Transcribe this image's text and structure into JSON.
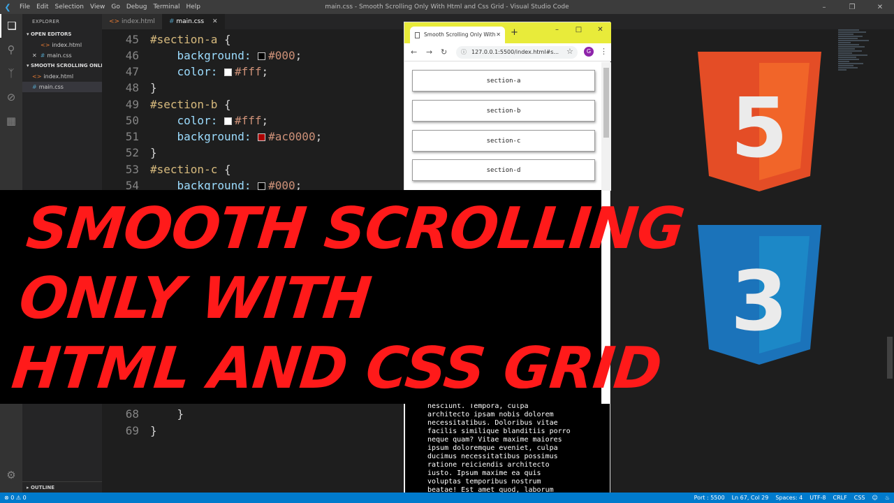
{
  "window": {
    "title": "main.css - Smooth Scrolling Only With Html and Css Grid - Visual Studio Code",
    "menu": [
      "File",
      "Edit",
      "Selection",
      "View",
      "Go",
      "Debug",
      "Terminal",
      "Help"
    ]
  },
  "sidebar": {
    "header": "EXPLORER",
    "open_editors_label": "OPEN EDITORS",
    "open_editors": [
      {
        "name": "index.html",
        "type": "html"
      },
      {
        "name": "main.css",
        "type": "css",
        "dirty_icon": "close-icon"
      }
    ],
    "project_label": "SMOOTH SCROLLING ONLI...",
    "files": [
      {
        "name": "index.html",
        "type": "html"
      },
      {
        "name": "main.css",
        "type": "css"
      }
    ],
    "outline_label": "OUTLINE"
  },
  "tabs": [
    {
      "label": "index.html",
      "active": false
    },
    {
      "label": "main.css",
      "active": true
    }
  ],
  "code": {
    "l45": {
      "num": "45",
      "selector": "#section-a",
      "brace": " {"
    },
    "l46": {
      "num": "46",
      "prop": "background:",
      "swatch": "#000000",
      "value": "#000",
      "end": ";"
    },
    "l47": {
      "num": "47",
      "prop": "color:",
      "swatch": "#ffffff",
      "value": "#fff",
      "end": ";"
    },
    "l48": {
      "num": "48",
      "text": "}"
    },
    "l49": {
      "num": "49",
      "selector": "#section-b",
      "brace": " {"
    },
    "l50": {
      "num": "50",
      "prop": "color:",
      "swatch": "#ffffff",
      "value": "#fff",
      "end": ";"
    },
    "l51": {
      "num": "51",
      "prop": "background:",
      "swatch": "#ac0000",
      "value": "#ac0000",
      "end": ";"
    },
    "l52": {
      "num": "52",
      "text": "}"
    },
    "l53": {
      "num": "53",
      "selector": "#section-c",
      "brace": " {"
    },
    "l54": {
      "num": "54",
      "prop": "background:",
      "swatch": "#000000",
      "value": "#000",
      "end": ";"
    },
    "l68": {
      "num": "68",
      "text": "}"
    },
    "l69": {
      "num": "69",
      "text": "}"
    }
  },
  "status": {
    "errors": "0",
    "warnings": "0",
    "port": "Port : 5500",
    "position": "Ln 67, Col 29",
    "spaces": "Spaces: 4",
    "encoding": "UTF-8",
    "eol": "CRLF",
    "language": "CSS"
  },
  "browser": {
    "tab_title": "Smooth Scrolling Only With",
    "url": "127.0.0.1:5500/index.html#s...",
    "avatar": "G",
    "header_color": "#e8eb3a",
    "nav_buttons": [
      "section-a",
      "section-b",
      "section-c",
      "section-d"
    ],
    "body_text": "nesciunt. Tempora, culpa\narchitecto ipsam nobis dolorem\nnecessitatibus. Doloribus vitae\nfacilis similique blanditiis porro\nneque quam? Vitae maxime maiores\nipsum doloremque eveniet, culpa\nducimus necessitatibus possimus\nratione reiciendis architecto\niusto. Ipsum maxime ea quis\nvoluptas temporibus nostrum\nbeatae! Est amet quod, laborum\nquos totam eum, ex molestias"
  },
  "headline": {
    "line1": "SMOOTH SCROLLING",
    "line2": "ONLY WITH",
    "line3": "HTML AND CSS GRID",
    "color": "#ff1a1a"
  },
  "logos": {
    "html": {
      "numeral": "5",
      "color": "#e44d26",
      "color_light": "#f16529"
    },
    "css": {
      "numeral": "3",
      "color": "#1b73ba",
      "color_light": "#1c88c7"
    }
  }
}
